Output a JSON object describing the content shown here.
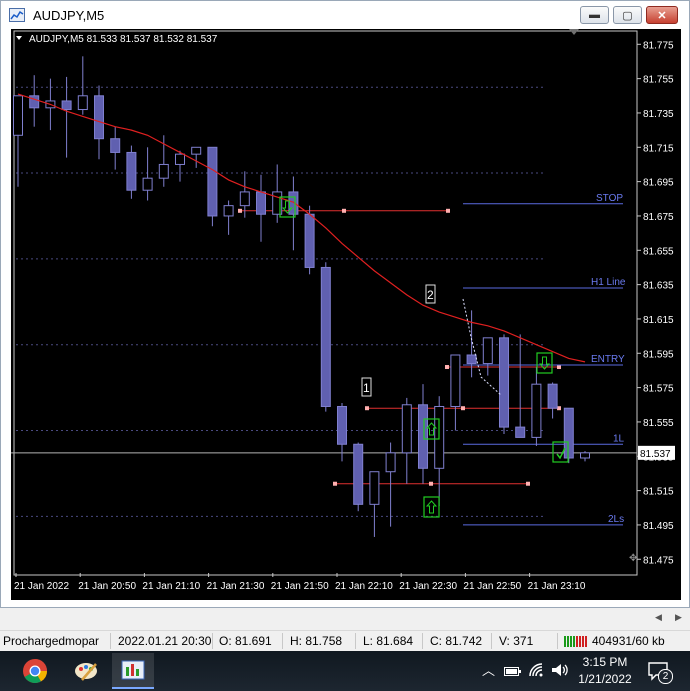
{
  "window": {
    "title": "AUDJPY,M5",
    "minimize": "▬",
    "maximize": "▢",
    "close": "✕"
  },
  "chart": {
    "info": "AUDJPY,M5  81.533 81.537 81.532 81.537",
    "current_price": "81.537",
    "price_labels": [
      "81.775",
      "81.755",
      "81.735",
      "81.715",
      "81.695",
      "81.675",
      "81.655",
      "81.635",
      "81.615",
      "81.595",
      "81.575",
      "81.555",
      "81.535",
      "81.515",
      "81.495",
      "81.475"
    ],
    "time_labels": [
      "21 Jan 2022",
      "21 Jan 20:50",
      "21 Jan 21:10",
      "21 Jan 21:30",
      "21 Jan 21:50",
      "21 Jan 22:10",
      "21 Jan 22:30",
      "21 Jan 22:50",
      "21 Jan 23:10"
    ],
    "line_labels": {
      "stop": "STOP",
      "h1": "H1 Line",
      "entry": "ENTRY",
      "l1": "1L",
      "l2": "2Ls"
    },
    "wave_labels": [
      "1",
      "2"
    ],
    "colors": {
      "bull_body": "#000000",
      "bear_body": "#6060b0",
      "candle_outline": "#8080d0",
      "ma_line": "#e02020",
      "level_line": "#e03030",
      "h_line": "#5a6adf",
      "dotted_grid": "#4a4a80",
      "arrow_box": "#22cc22"
    }
  },
  "chart_data": {
    "type": "candlestick",
    "symbol": "AUDJPY,M5",
    "ylim": [
      81.467,
      81.781
    ],
    "candles": [
      {
        "o": 81.722,
        "h": 81.745,
        "l": 81.692,
        "c": 81.745
      },
      {
        "o": 81.745,
        "h": 81.757,
        "l": 81.727,
        "c": 81.738
      },
      {
        "o": 81.738,
        "h": 81.755,
        "l": 81.725,
        "c": 81.742
      },
      {
        "o": 81.742,
        "h": 81.756,
        "l": 81.709,
        "c": 81.737
      },
      {
        "o": 81.737,
        "h": 81.768,
        "l": 81.734,
        "c": 81.745
      },
      {
        "o": 81.745,
        "h": 81.751,
        "l": 81.708,
        "c": 81.72
      },
      {
        "o": 81.72,
        "h": 81.727,
        "l": 81.702,
        "c": 81.712
      },
      {
        "o": 81.712,
        "h": 81.716,
        "l": 81.685,
        "c": 81.69
      },
      {
        "o": 81.69,
        "h": 81.715,
        "l": 81.684,
        "c": 81.697
      },
      {
        "o": 81.697,
        "h": 81.722,
        "l": 81.692,
        "c": 81.705
      },
      {
        "o": 81.705,
        "h": 81.713,
        "l": 81.695,
        "c": 81.711
      },
      {
        "o": 81.711,
        "h": 81.715,
        "l": 81.703,
        "c": 81.715
      },
      {
        "o": 81.715,
        "h": 81.715,
        "l": 81.669,
        "c": 81.675
      },
      {
        "o": 81.675,
        "h": 81.684,
        "l": 81.664,
        "c": 81.681
      },
      {
        "o": 81.681,
        "h": 81.701,
        "l": 81.674,
        "c": 81.689
      },
      {
        "o": 81.689,
        "h": 81.699,
        "l": 81.66,
        "c": 81.676
      },
      {
        "o": 81.676,
        "h": 81.705,
        "l": 81.671,
        "c": 81.689
      },
      {
        "o": 81.689,
        "h": 81.698,
        "l": 81.655,
        "c": 81.676
      },
      {
        "o": 81.676,
        "h": 81.681,
        "l": 81.641,
        "c": 81.645
      },
      {
        "o": 81.645,
        "h": 81.648,
        "l": 81.561,
        "c": 81.564
      },
      {
        "o": 81.564,
        "h": 81.566,
        "l": 81.532,
        "c": 81.542
      },
      {
        "o": 81.542,
        "h": 81.543,
        "l": 81.503,
        "c": 81.507
      },
      {
        "o": 81.507,
        "h": 81.522,
        "l": 81.488,
        "c": 81.526
      },
      {
        "o": 81.526,
        "h": 81.543,
        "l": 81.494,
        "c": 81.537
      },
      {
        "o": 81.537,
        "h": 81.569,
        "l": 81.519,
        "c": 81.565
      },
      {
        "o": 81.565,
        "h": 81.577,
        "l": 81.519,
        "c": 81.528
      },
      {
        "o": 81.528,
        "h": 81.57,
        "l": 81.506,
        "c": 81.564
      },
      {
        "o": 81.564,
        "h": 81.586,
        "l": 81.55,
        "c": 81.594
      },
      {
        "o": 81.594,
        "h": 81.62,
        "l": 81.581,
        "c": 81.589
      },
      {
        "o": 81.589,
        "h": 81.603,
        "l": 81.582,
        "c": 81.604
      },
      {
        "o": 81.604,
        "h": 81.606,
        "l": 81.548,
        "c": 81.552
      },
      {
        "o": 81.552,
        "h": 81.606,
        "l": 81.548,
        "c": 81.546
      },
      {
        "o": 81.546,
        "h": 81.587,
        "l": 81.541,
        "c": 81.577
      },
      {
        "o": 81.577,
        "h": 81.578,
        "l": 81.557,
        "c": 81.563
      },
      {
        "o": 81.563,
        "h": 81.559,
        "l": 81.531,
        "c": 81.534
      },
      {
        "o": 81.534,
        "h": 81.538,
        "l": 81.532,
        "c": 81.537
      }
    ],
    "ma": [
      81.746,
      81.743,
      81.74,
      81.736,
      81.733,
      81.73,
      81.727,
      81.725,
      81.722,
      81.717,
      81.712,
      81.707,
      81.702,
      81.696,
      81.692,
      81.689,
      81.686,
      81.683,
      81.676,
      81.668,
      81.659,
      81.651,
      81.643,
      81.636,
      81.629,
      81.623,
      81.619,
      81.616,
      81.613,
      81.611,
      81.608,
      81.604,
      81.6,
      81.596,
      81.592,
      81.59
    ],
    "levels": {
      "stop": 81.678,
      "h1": 81.633,
      "entry": 81.587,
      "l1": 81.542,
      "l2": 81.495,
      "red_mid": 81.563,
      "red_low": 81.519
    },
    "dotted_levels": [
      81.75,
      81.7,
      81.65,
      81.6,
      81.55,
      81.5
    ]
  },
  "status": {
    "profile": "Prochargedmopar",
    "datetime": "2022.01.21 20:30",
    "open": "O: 81.691",
    "high": "H: 81.758",
    "low": "L: 81.684",
    "close": "C: 81.742",
    "volume": "V: 371",
    "traffic": "404931/60 kb"
  },
  "taskbar": {
    "time": "3:15 PM",
    "date": "1/21/2022",
    "notifications": "2"
  }
}
